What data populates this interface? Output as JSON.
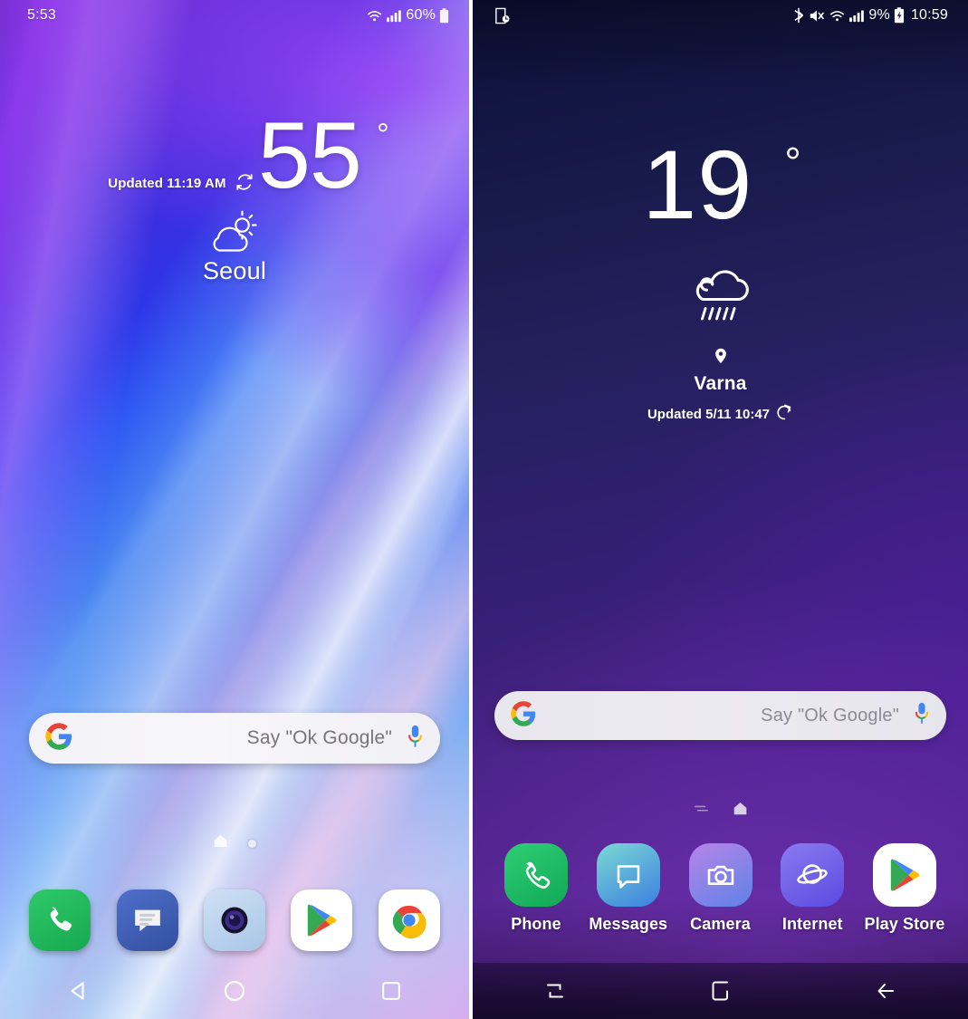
{
  "meta": {
    "comparison_title": "Android home screens side by side",
    "left_device_ui": "LG UX launcher",
    "right_device_ui": "Samsung Experience launcher"
  },
  "left_phone": {
    "status_bar": {
      "time": "5:53",
      "battery_percent": "60%",
      "icons": [
        "wifi-icon",
        "signal-icon",
        "battery-icon"
      ]
    },
    "weather_widget": {
      "updated_label": "Updated 11:19 AM",
      "refresh_icon": "refresh-icon",
      "temperature": "55",
      "degree_symbol": "°",
      "condition_icon": "partly-cloudy-icon",
      "city": "Seoul"
    },
    "search_bar": {
      "logo_icon": "google-g-icon",
      "placeholder": "Say \"Ok Google\"",
      "mic_icon": "microphone-icon"
    },
    "page_indicator": {
      "home_icon": "home-page-icon",
      "dots": 1
    },
    "dock": [
      {
        "name": "phone",
        "icon": "phone-handset-icon",
        "color": "#25ba5f"
      },
      {
        "name": "messages",
        "icon": "message-bubble-icon",
        "color": "#3b5bb5"
      },
      {
        "name": "camera",
        "icon": "camera-lens-icon",
        "color": "#b9d2ef"
      },
      {
        "name": "play-store",
        "icon": "play-store-icon",
        "color": "#ffffff"
      },
      {
        "name": "chrome",
        "icon": "chrome-icon",
        "color": "#ffffff"
      }
    ],
    "nav_bar": [
      {
        "name": "back",
        "icon": "back-triangle-icon"
      },
      {
        "name": "home",
        "icon": "home-circle-icon"
      },
      {
        "name": "recents",
        "icon": "recents-square-icon"
      }
    ]
  },
  "right_phone": {
    "status_bar": {
      "clock": "10:59",
      "battery_percent": "9%",
      "left_icons": [
        "screen-timeout-icon"
      ],
      "right_icons": [
        "bluetooth-icon",
        "mute-icon",
        "wifi-icon",
        "signal-icon",
        "battery-charging-icon"
      ]
    },
    "weather_widget": {
      "temperature": "19",
      "degree_symbol": "°",
      "condition_icon": "rain-cloud-icon",
      "location_pin_icon": "location-pin-icon",
      "city": "Varna",
      "updated_label": "Updated 5/11 10:47",
      "refresh_icon": "refresh-icon"
    },
    "search_bar": {
      "logo_icon": "google-g-icon",
      "placeholder": "Say \"Ok Google\"",
      "mic_icon": "microphone-icon"
    },
    "page_indicator": {
      "feed_icon": "bixby-feed-icon",
      "home_icon": "home-page-icon"
    },
    "dock": [
      {
        "label": "Phone",
        "icon": "phone-handset-icon",
        "color": "#21b663"
      },
      {
        "label": "Messages",
        "icon": "message-bubble-icon",
        "color": "#3fb9d8"
      },
      {
        "label": "Camera",
        "icon": "camera-icon",
        "color": "#8e7de8"
      },
      {
        "label": "Internet",
        "icon": "internet-planet-icon",
        "color": "#6e5ce8"
      },
      {
        "label": "Play Store",
        "icon": "play-store-icon",
        "color": "#ffffff"
      }
    ],
    "nav_bar": [
      {
        "name": "recents",
        "icon": "recents-lines-icon"
      },
      {
        "name": "home",
        "icon": "home-square-icon"
      },
      {
        "name": "back",
        "icon": "back-arrow-icon"
      }
    ]
  },
  "colors": {
    "left_accent": "#1c3ff0",
    "right_accent": "#42207f",
    "google_blue": "#4285f4",
    "google_red": "#ea4335",
    "google_yellow": "#fbbc05",
    "google_green": "#34a853",
    "status_text": "#ffffff"
  }
}
